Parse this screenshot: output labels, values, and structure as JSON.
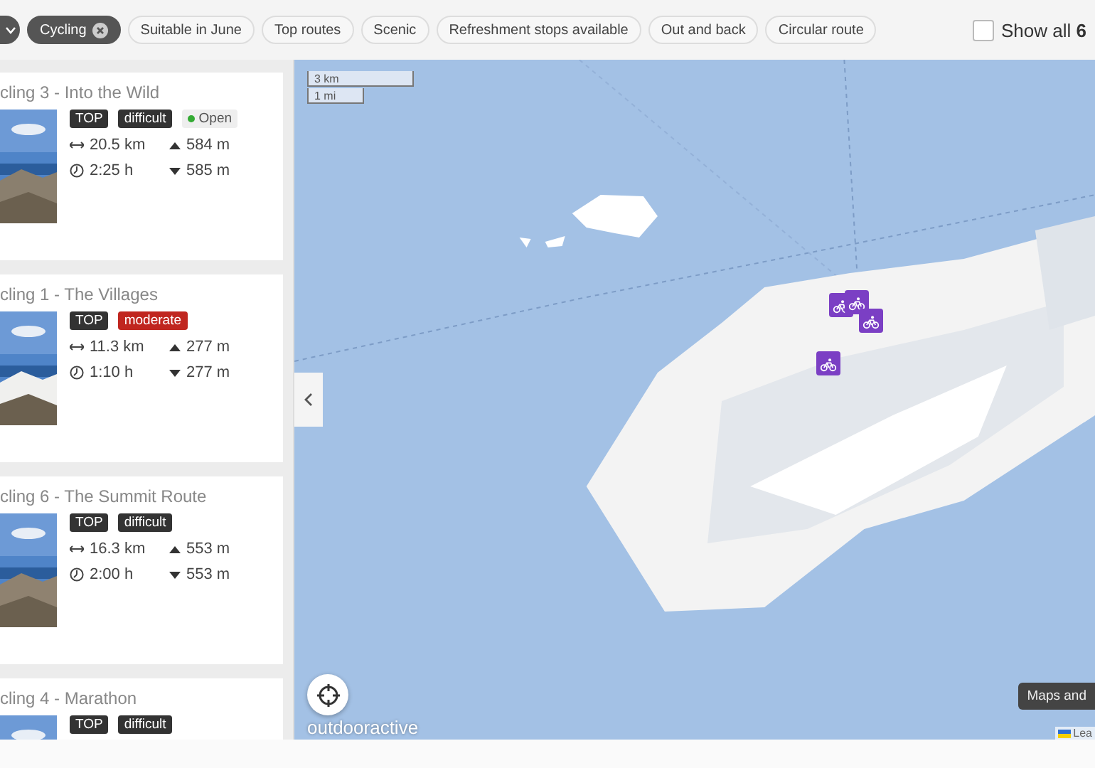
{
  "filters": [
    {
      "label": "Cycling",
      "kind": "active",
      "selected": true
    },
    {
      "label": "Suitable in June",
      "kind": "option",
      "selected": false
    },
    {
      "label": "Top routes",
      "kind": "option",
      "selected": false
    },
    {
      "label": "Scenic",
      "kind": "option",
      "selected": false
    },
    {
      "label": "Refreshment stops available",
      "kind": "option",
      "selected": false
    },
    {
      "label": "Out and back",
      "kind": "option",
      "selected": false
    },
    {
      "label": "Circular route",
      "kind": "option",
      "selected": false
    }
  ],
  "show_all": {
    "label": "Show all **6**",
    "checked": false
  },
  "tours": [
    {
      "title": "cling 3 - Into the Wild",
      "tags": [
        {
          "label": "TOP",
          "kind": "top"
        },
        {
          "label": "difficult",
          "kind": "difficult"
        },
        {
          "label": "Open",
          "kind": "status"
        }
      ],
      "distance": "20.5 km",
      "ascent": "584 m",
      "duration": "2:25 h",
      "descent": "585 m"
    },
    {
      "title": "cling 1 - The Villages",
      "tags": [
        {
          "label": "TOP",
          "kind": "top"
        },
        {
          "label": "moderate",
          "kind": "moderate"
        }
      ],
      "distance": "11.3 km",
      "ascent": "277 m",
      "duration": "1:10 h",
      "descent": "277 m"
    },
    {
      "title": "cling 6 - The Summit Route",
      "tags": [
        {
          "label": "TOP",
          "kind": "top"
        },
        {
          "label": "difficult",
          "kind": "difficult"
        }
      ],
      "distance": "16.3 km",
      "ascent": "553 m",
      "duration": "2:00 h",
      "descent": "553 m"
    },
    {
      "title": "cling 4 - Marathon",
      "tags": [
        {
          "label": "TOP",
          "kind": "top"
        },
        {
          "label": "difficult",
          "kind": "difficult"
        }
      ]
    }
  ],
  "map": {
    "scale": [
      "3 km",
      "1 mi"
    ],
    "logo": "outdooractive",
    "tooltip": "Maps and",
    "attribution": "Lea"
  }
}
